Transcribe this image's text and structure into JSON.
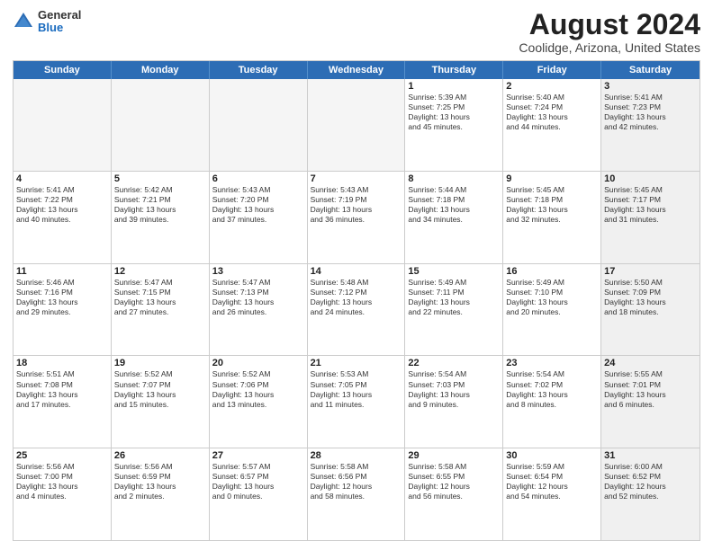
{
  "logo": {
    "general": "General",
    "blue": "Blue"
  },
  "title": "August 2024",
  "subtitle": "Coolidge, Arizona, United States",
  "days": [
    "Sunday",
    "Monday",
    "Tuesday",
    "Wednesday",
    "Thursday",
    "Friday",
    "Saturday"
  ],
  "rows": [
    [
      {
        "day": "",
        "empty": true
      },
      {
        "day": "",
        "empty": true
      },
      {
        "day": "",
        "empty": true
      },
      {
        "day": "",
        "empty": true
      },
      {
        "day": "1",
        "lines": [
          "Sunrise: 5:39 AM",
          "Sunset: 7:25 PM",
          "Daylight: 13 hours",
          "and 45 minutes."
        ]
      },
      {
        "day": "2",
        "lines": [
          "Sunrise: 5:40 AM",
          "Sunset: 7:24 PM",
          "Daylight: 13 hours",
          "and 44 minutes."
        ]
      },
      {
        "day": "3",
        "shaded": true,
        "lines": [
          "Sunrise: 5:41 AM",
          "Sunset: 7:23 PM",
          "Daylight: 13 hours",
          "and 42 minutes."
        ]
      }
    ],
    [
      {
        "day": "4",
        "lines": [
          "Sunrise: 5:41 AM",
          "Sunset: 7:22 PM",
          "Daylight: 13 hours",
          "and 40 minutes."
        ]
      },
      {
        "day": "5",
        "lines": [
          "Sunrise: 5:42 AM",
          "Sunset: 7:21 PM",
          "Daylight: 13 hours",
          "and 39 minutes."
        ]
      },
      {
        "day": "6",
        "lines": [
          "Sunrise: 5:43 AM",
          "Sunset: 7:20 PM",
          "Daylight: 13 hours",
          "and 37 minutes."
        ]
      },
      {
        "day": "7",
        "lines": [
          "Sunrise: 5:43 AM",
          "Sunset: 7:19 PM",
          "Daylight: 13 hours",
          "and 36 minutes."
        ]
      },
      {
        "day": "8",
        "lines": [
          "Sunrise: 5:44 AM",
          "Sunset: 7:18 PM",
          "Daylight: 13 hours",
          "and 34 minutes."
        ]
      },
      {
        "day": "9",
        "lines": [
          "Sunrise: 5:45 AM",
          "Sunset: 7:18 PM",
          "Daylight: 13 hours",
          "and 32 minutes."
        ]
      },
      {
        "day": "10",
        "shaded": true,
        "lines": [
          "Sunrise: 5:45 AM",
          "Sunset: 7:17 PM",
          "Daylight: 13 hours",
          "and 31 minutes."
        ]
      }
    ],
    [
      {
        "day": "11",
        "lines": [
          "Sunrise: 5:46 AM",
          "Sunset: 7:16 PM",
          "Daylight: 13 hours",
          "and 29 minutes."
        ]
      },
      {
        "day": "12",
        "lines": [
          "Sunrise: 5:47 AM",
          "Sunset: 7:15 PM",
          "Daylight: 13 hours",
          "and 27 minutes."
        ]
      },
      {
        "day": "13",
        "lines": [
          "Sunrise: 5:47 AM",
          "Sunset: 7:13 PM",
          "Daylight: 13 hours",
          "and 26 minutes."
        ]
      },
      {
        "day": "14",
        "lines": [
          "Sunrise: 5:48 AM",
          "Sunset: 7:12 PM",
          "Daylight: 13 hours",
          "and 24 minutes."
        ]
      },
      {
        "day": "15",
        "lines": [
          "Sunrise: 5:49 AM",
          "Sunset: 7:11 PM",
          "Daylight: 13 hours",
          "and 22 minutes."
        ]
      },
      {
        "day": "16",
        "lines": [
          "Sunrise: 5:49 AM",
          "Sunset: 7:10 PM",
          "Daylight: 13 hours",
          "and 20 minutes."
        ]
      },
      {
        "day": "17",
        "shaded": true,
        "lines": [
          "Sunrise: 5:50 AM",
          "Sunset: 7:09 PM",
          "Daylight: 13 hours",
          "and 18 minutes."
        ]
      }
    ],
    [
      {
        "day": "18",
        "lines": [
          "Sunrise: 5:51 AM",
          "Sunset: 7:08 PM",
          "Daylight: 13 hours",
          "and 17 minutes."
        ]
      },
      {
        "day": "19",
        "lines": [
          "Sunrise: 5:52 AM",
          "Sunset: 7:07 PM",
          "Daylight: 13 hours",
          "and 15 minutes."
        ]
      },
      {
        "day": "20",
        "lines": [
          "Sunrise: 5:52 AM",
          "Sunset: 7:06 PM",
          "Daylight: 13 hours",
          "and 13 minutes."
        ]
      },
      {
        "day": "21",
        "lines": [
          "Sunrise: 5:53 AM",
          "Sunset: 7:05 PM",
          "Daylight: 13 hours",
          "and 11 minutes."
        ]
      },
      {
        "day": "22",
        "lines": [
          "Sunrise: 5:54 AM",
          "Sunset: 7:03 PM",
          "Daylight: 13 hours",
          "and 9 minutes."
        ]
      },
      {
        "day": "23",
        "lines": [
          "Sunrise: 5:54 AM",
          "Sunset: 7:02 PM",
          "Daylight: 13 hours",
          "and 8 minutes."
        ]
      },
      {
        "day": "24",
        "shaded": true,
        "lines": [
          "Sunrise: 5:55 AM",
          "Sunset: 7:01 PM",
          "Daylight: 13 hours",
          "and 6 minutes."
        ]
      }
    ],
    [
      {
        "day": "25",
        "lines": [
          "Sunrise: 5:56 AM",
          "Sunset: 7:00 PM",
          "Daylight: 13 hours",
          "and 4 minutes."
        ]
      },
      {
        "day": "26",
        "lines": [
          "Sunrise: 5:56 AM",
          "Sunset: 6:59 PM",
          "Daylight: 13 hours",
          "and 2 minutes."
        ]
      },
      {
        "day": "27",
        "lines": [
          "Sunrise: 5:57 AM",
          "Sunset: 6:57 PM",
          "Daylight: 13 hours",
          "and 0 minutes."
        ]
      },
      {
        "day": "28",
        "lines": [
          "Sunrise: 5:58 AM",
          "Sunset: 6:56 PM",
          "Daylight: 12 hours",
          "and 58 minutes."
        ]
      },
      {
        "day": "29",
        "lines": [
          "Sunrise: 5:58 AM",
          "Sunset: 6:55 PM",
          "Daylight: 12 hours",
          "and 56 minutes."
        ]
      },
      {
        "day": "30",
        "lines": [
          "Sunrise: 5:59 AM",
          "Sunset: 6:54 PM",
          "Daylight: 12 hours",
          "and 54 minutes."
        ]
      },
      {
        "day": "31",
        "shaded": true,
        "lines": [
          "Sunrise: 6:00 AM",
          "Sunset: 6:52 PM",
          "Daylight: 12 hours",
          "and 52 minutes."
        ]
      }
    ]
  ]
}
